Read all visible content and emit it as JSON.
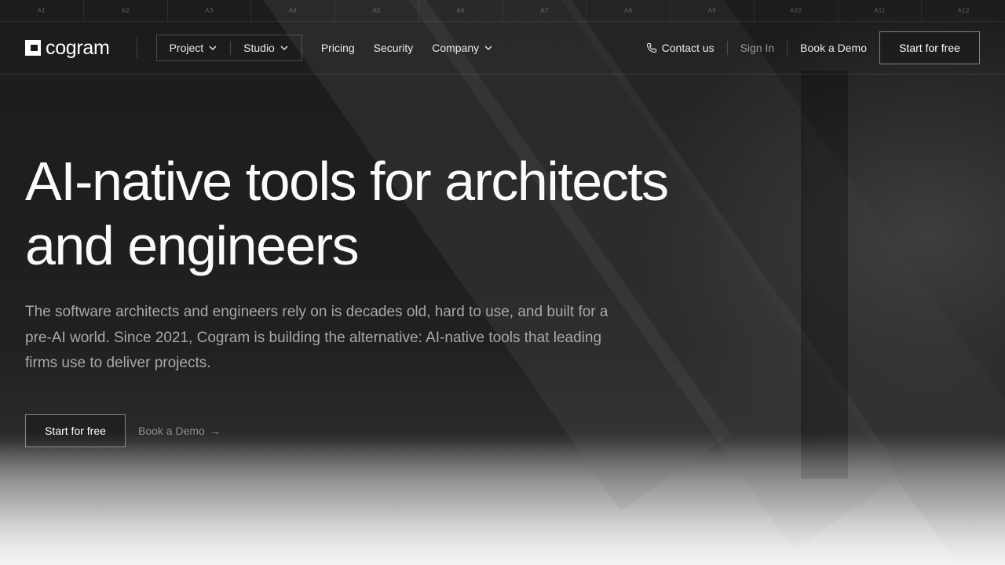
{
  "ruler": [
    "A1",
    "A2",
    "A3",
    "A4",
    "A5",
    "A6",
    "A7",
    "A8",
    "A9",
    "A10",
    "A11",
    "A12"
  ],
  "nav": {
    "logo_text": "cogram",
    "dropdowns": [
      {
        "label": "Project"
      },
      {
        "label": "Studio"
      }
    ],
    "links": [
      {
        "label": "Pricing"
      },
      {
        "label": "Security"
      },
      {
        "label": "Company"
      }
    ],
    "contact_label": "Contact us",
    "signin_label": "Sign In",
    "book_label": "Book a Demo",
    "start_label": "Start for free"
  },
  "hero": {
    "title_line1": "AI-native tools for architects",
    "title_line2": "and engineers",
    "subtitle": "The software architects and engineers rely on is decades old, hard to use, and built for a pre-AI world. Since 2021, Cogram is building the alternative: AI-native tools that leading firms use to deliver projects.",
    "cta_start": "Start for free",
    "cta_demo": "Book a Demo",
    "cta_demo_arrow": "→"
  }
}
